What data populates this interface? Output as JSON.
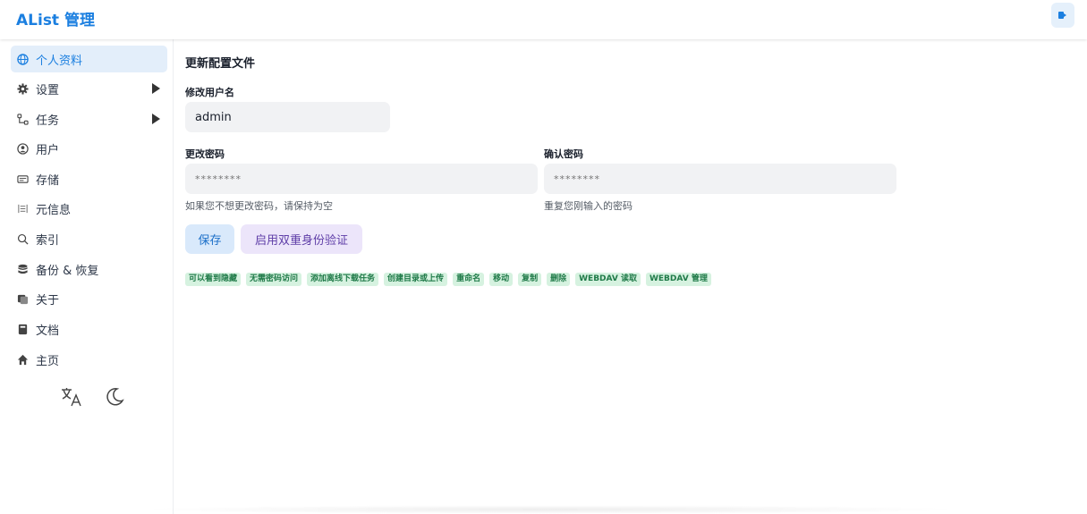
{
  "header": {
    "title": "AList 管理",
    "logout_icon": "logout-icon"
  },
  "sidebar": {
    "items": [
      {
        "label": "个人资料",
        "icon": "globe-icon",
        "active": true
      },
      {
        "label": "设置",
        "icon": "gear-icon",
        "expandable": true
      },
      {
        "label": "任务",
        "icon": "workflow-icon",
        "expandable": true
      },
      {
        "label": "用户",
        "icon": "user-circle-icon"
      },
      {
        "label": "存储",
        "icon": "storage-icon"
      },
      {
        "label": "元信息",
        "icon": "metadata-icon"
      },
      {
        "label": "索引",
        "icon": "search-icon"
      },
      {
        "label": "备份 & 恢复",
        "icon": "database-icon"
      },
      {
        "label": "关于",
        "icon": "about-icon"
      },
      {
        "label": "文档",
        "icon": "book-icon"
      },
      {
        "label": "主页",
        "icon": "home-icon"
      }
    ],
    "bottom": {
      "language_icon": "translate-icon",
      "theme_icon": "moon-icon"
    }
  },
  "main": {
    "title": "更新配置文件",
    "username": {
      "label": "修改用户名",
      "value": "admin"
    },
    "password": {
      "label": "更改密码",
      "placeholder": "********",
      "help": "如果您不想更改密码，请保持为空"
    },
    "confirm_password": {
      "label": "确认密码",
      "placeholder": "********",
      "help": "重复您刚输入的密码"
    },
    "buttons": {
      "save": "保存",
      "enable_2fa": "启用双重身份验证"
    },
    "permissions": [
      "可以看到隐藏",
      "无需密码访问",
      "添加离线下载任务",
      "创建目录或上传",
      "重命名",
      "移动",
      "复制",
      "删除",
      "WEBDAV 读取",
      "WEBDAV 管理"
    ]
  },
  "colors": {
    "accent": "#1b7fe0",
    "active_bg": "#e3eefa",
    "tag_bg": "#d6f2e0",
    "tag_text": "#1f7a48",
    "save_bg": "#d9e9fb",
    "twofa_bg": "#ece5fa"
  }
}
